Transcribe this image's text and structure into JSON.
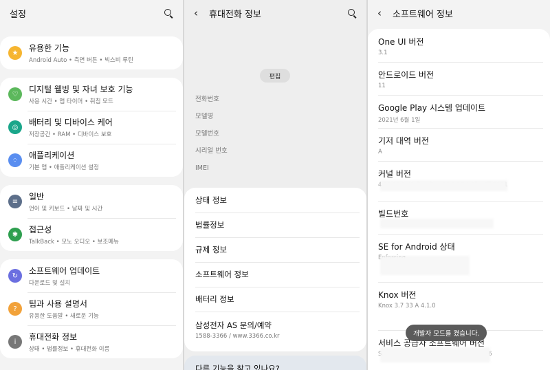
{
  "settings": {
    "title": "설정",
    "groups": [
      [
        {
          "label": "유용한 기능",
          "sub": "Android Auto • 측면 버튼 • 빅스비 루틴",
          "icon": "star-icon",
          "color": "#f6b530",
          "glyph": "★"
        }
      ],
      [
        {
          "label": "디지털 웰빙 및 자녀 보호 기능",
          "sub": "사용 시간 • 앱 타이머 • 취침 모드",
          "icon": "wellbeing-icon",
          "color": "#5cb85c",
          "glyph": "♡"
        },
        {
          "label": "배터리 및 디바이스 케어",
          "sub": "저장공간 • RAM • 디바이스 보호",
          "icon": "device-care-icon",
          "color": "#1aa68a",
          "glyph": "◎"
        },
        {
          "label": "애플리케이션",
          "sub": "기본 앱 • 애플리케이션 설정",
          "icon": "apps-icon",
          "color": "#5a8ef0",
          "glyph": "⁘"
        }
      ],
      [
        {
          "label": "일반",
          "sub": "언어 및 키보드 • 날짜 및 시간",
          "icon": "general-icon",
          "color": "#5d6f8a",
          "glyph": "≡"
        },
        {
          "label": "접근성",
          "sub": "TalkBack • 모노 오디오 • 보조메뉴",
          "icon": "accessibility-icon",
          "color": "#2e9f4f",
          "glyph": "✱"
        }
      ],
      [
        {
          "label": "소프트웨어 업데이트",
          "sub": "다운로드 및 설치",
          "icon": "software-update-icon",
          "color": "#6b6fe0",
          "glyph": "↻"
        },
        {
          "label": "팁과 사용 설명서",
          "sub": "유용한 도움말 • 새로운 기능",
          "icon": "tips-icon",
          "color": "#f2a23a",
          "glyph": "?"
        },
        {
          "label": "휴대전화 정보",
          "sub": "상태 • 법률정보 • 휴대전화 이름",
          "icon": "phone-info-icon",
          "color": "#777777",
          "glyph": "i"
        }
      ]
    ]
  },
  "phone_info": {
    "title": "휴대전화 정보",
    "edit_label": "편집",
    "fields": [
      "전화번호",
      "모델명",
      "모델번호",
      "시리얼 번호",
      "IMEI"
    ],
    "items": [
      {
        "label": "상태 정보",
        "sub": ""
      },
      {
        "label": "법률정보",
        "sub": ""
      },
      {
        "label": "규제 정보",
        "sub": ""
      },
      {
        "label": "소프트웨어 정보",
        "sub": ""
      },
      {
        "label": "배터리 정보",
        "sub": ""
      },
      {
        "label": "삼성전자 AS 문의/예약",
        "sub": "1588-3366 / www.3366.co.kr"
      }
    ],
    "bottom_text": "다른 기능을 찾고 있나요?"
  },
  "software_info": {
    "title": "소프트웨어 정보",
    "items": [
      {
        "label": "One UI 버전",
        "sub": "3.1",
        "h": 48
      },
      {
        "label": "안드로이드 버전",
        "sub": "11",
        "h": 48
      },
      {
        "label": "Google Play 시스템 업데이트",
        "sub": "2021년 6월 1일",
        "h": 48
      },
      {
        "label": "기저 대역 버전",
        "sub": "A",
        "h": 48
      },
      {
        "label": "커널 버전",
        "sub": "4.19.113 #1 Thu Dec 30 14:24:05 KST 2021",
        "h": 58
      },
      {
        "label": "빌드번호",
        "sub": "",
        "h": 48
      },
      {
        "label": "SE for Android 상태",
        "sub": "Enforcing",
        "h": 70
      },
      {
        "label": "Knox 버전",
        "sub": "Knox 3.7  33  A 4.1.0",
        "h": 70
      },
      {
        "label": "서비스 공급자 소프트웨어 버전",
        "sub": "SAOMC_SM-A516N_OXM_LUC_RR_0006",
        "h": 48
      }
    ],
    "toast": "개발자 모드를 켰습니다."
  }
}
